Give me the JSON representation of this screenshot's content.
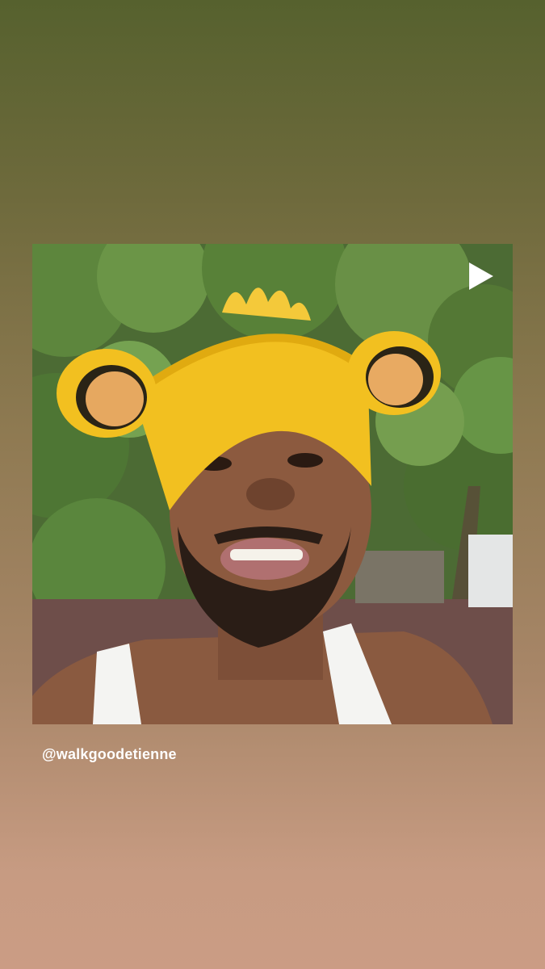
{
  "story": {
    "shared_post": {
      "media_kind": "reel",
      "reel_icon": "play-triangle-icon",
      "photo_subject": "smiling man with beard wearing yellow fuzzy lion-ears headband and white tank top in front of green trees"
    },
    "mention": {
      "username": "@walkgoodetienne"
    }
  },
  "colors": {
    "gradient_top": "#56612e",
    "gradient_bottom": "#cb9c84",
    "username_text": "#ffffff"
  }
}
